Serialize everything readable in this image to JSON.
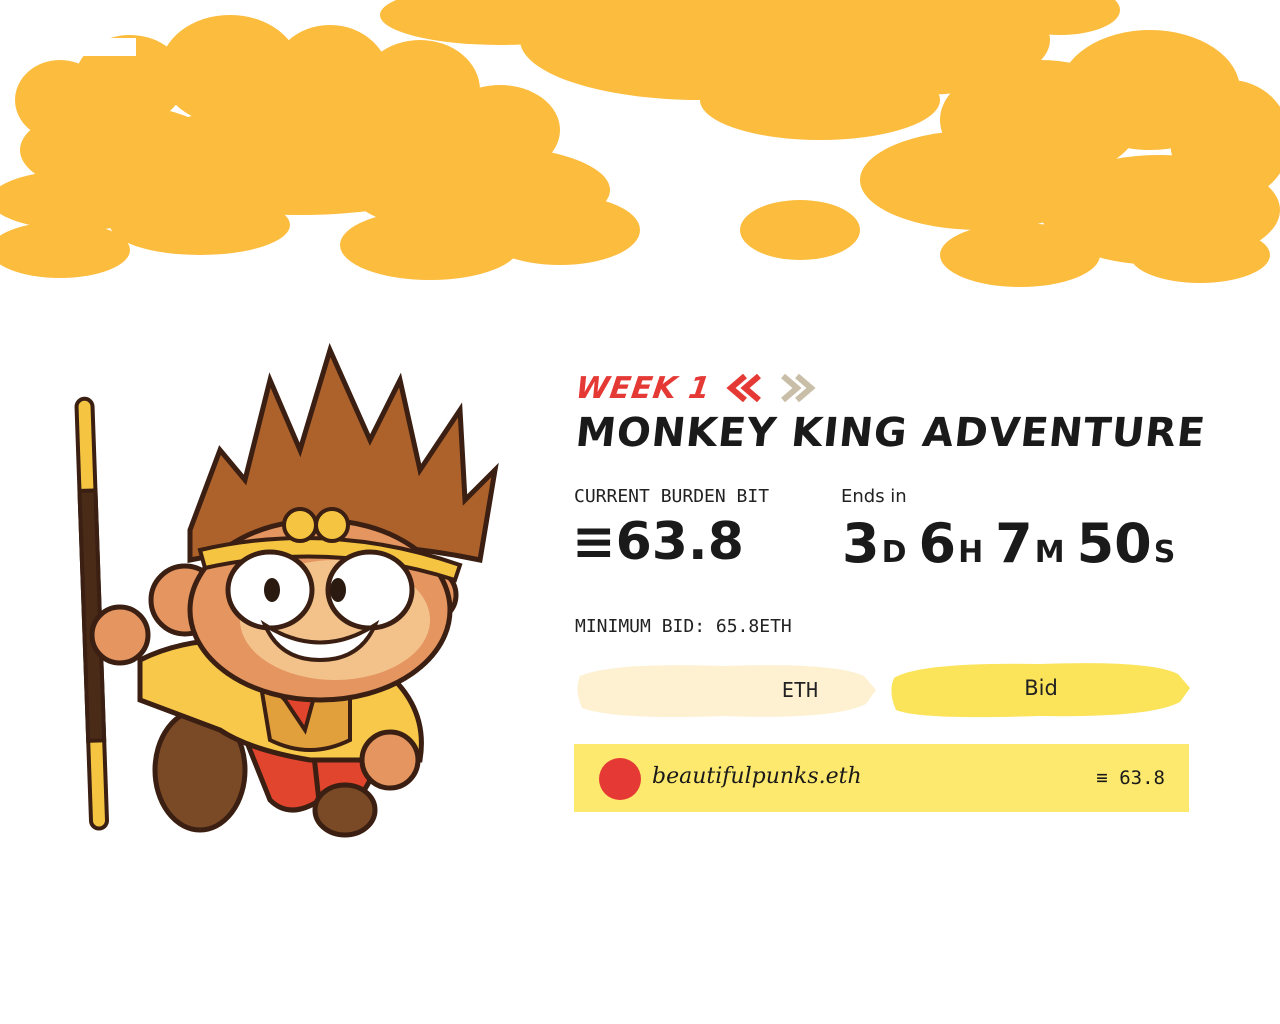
{
  "auction": {
    "week_label": "WEEK 1",
    "title": "MONKEY KING ADVENTURE",
    "current_bid_label": "CURRENT BURDEN BIT",
    "current_bid_value": "≡63.8",
    "ends_in_label": "Ends in",
    "countdown": {
      "days": "3",
      "days_unit": "D",
      "hours": "6",
      "hours_unit": "H",
      "minutes": "7",
      "minutes_unit": "M",
      "seconds": "50",
      "seconds_unit": "S"
    },
    "minimum_bid": "MINIMUM BID: 65.8ETH"
  },
  "form": {
    "eth_value": "",
    "eth_suffix": "ETH",
    "bid_button_label": "Bid"
  },
  "bids": [
    {
      "bidder": "beautifulpunks.eth",
      "amount": "≡ 63.8"
    }
  ],
  "colors": {
    "cloud": "#fcbc3d",
    "accent_red": "#e53935",
    "arrow_next": "#c9bfa8",
    "input_bg": "#fdf1d2",
    "button_bg": "#fbe35a",
    "bid_row_bg": "#fde96d"
  }
}
